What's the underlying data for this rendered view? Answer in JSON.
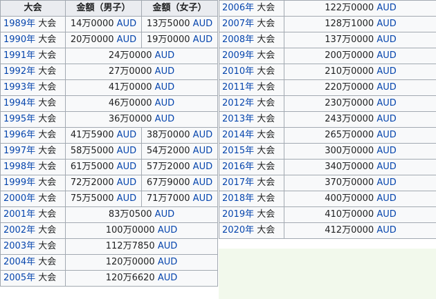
{
  "left_table": {
    "headers": [
      "大会",
      "金額（男子）",
      "金額（女子）"
    ],
    "rows": [
      {
        "year": "1989年",
        "suffix": "大会",
        "men": "14万0000",
        "women": "13万5000",
        "currency": "AUD"
      },
      {
        "year": "1990年",
        "suffix": "大会",
        "men": "20万0000",
        "women": "19万0000",
        "currency": "AUD"
      },
      {
        "year": "1991年",
        "suffix": "大会",
        "amount": "24万0000",
        "currency": "AUD"
      },
      {
        "year": "1992年",
        "suffix": "大会",
        "amount": "27万0000",
        "currency": "AUD"
      },
      {
        "year": "1993年",
        "suffix": "大会",
        "amount": "41万0000",
        "currency": "AUD"
      },
      {
        "year": "1994年",
        "suffix": "大会",
        "amount": "46万0000",
        "currency": "AUD"
      },
      {
        "year": "1995年",
        "suffix": "大会",
        "amount": "36万0000",
        "currency": "AUD"
      },
      {
        "year": "1996年",
        "suffix": "大会",
        "men": "41万5900",
        "women": "38万0000",
        "currency": "AUD"
      },
      {
        "year": "1997年",
        "suffix": "大会",
        "men": "58万5000",
        "women": "54万2000",
        "currency": "AUD"
      },
      {
        "year": "1998年",
        "suffix": "大会",
        "men": "61万5000",
        "women": "57万2000",
        "currency": "AUD"
      },
      {
        "year": "1999年",
        "suffix": "大会",
        "men": "72万2000",
        "women": "67万9000",
        "currency": "AUD"
      },
      {
        "year": "2000年",
        "suffix": "大会",
        "men": "75万5000",
        "women": "71万7000",
        "currency": "AUD"
      },
      {
        "year": "2001年",
        "suffix": "大会",
        "amount": "83万0500",
        "currency": "AUD"
      },
      {
        "year": "2002年",
        "suffix": "大会",
        "amount": "100万0000",
        "currency": "AUD"
      },
      {
        "year": "2003年",
        "suffix": "大会",
        "amount": "112万7850",
        "currency": "AUD"
      },
      {
        "year": "2004年",
        "suffix": "大会",
        "amount": "120万0000",
        "currency": "AUD"
      },
      {
        "year": "2005年",
        "suffix": "大会",
        "amount": "120万6620",
        "currency": "AUD"
      }
    ]
  },
  "right_table": {
    "rows": [
      {
        "year": "2006年",
        "suffix": "大会",
        "amount": "122万0000",
        "currency": "AUD"
      },
      {
        "year": "2007年",
        "suffix": "大会",
        "amount": "128万1000",
        "currency": "AUD"
      },
      {
        "year": "2008年",
        "suffix": "大会",
        "amount": "137万0000",
        "currency": "AUD"
      },
      {
        "year": "2009年",
        "suffix": "大会",
        "amount": "200万0000",
        "currency": "AUD"
      },
      {
        "year": "2010年",
        "suffix": "大会",
        "amount": "210万0000",
        "currency": "AUD"
      },
      {
        "year": "2011年",
        "suffix": "大会",
        "amount": "220万0000",
        "currency": "AUD"
      },
      {
        "year": "2012年",
        "suffix": "大会",
        "amount": "230万0000",
        "currency": "AUD"
      },
      {
        "year": "2013年",
        "suffix": "大会",
        "amount": "243万0000",
        "currency": "AUD"
      },
      {
        "year": "2014年",
        "suffix": "大会",
        "amount": "265万0000",
        "currency": "AUD"
      },
      {
        "year": "2015年",
        "suffix": "大会",
        "amount": "300万0000",
        "currency": "AUD"
      },
      {
        "year": "2016年",
        "suffix": "大会",
        "amount": "340万0000",
        "currency": "AUD"
      },
      {
        "year": "2017年",
        "suffix": "大会",
        "amount": "370万0000",
        "currency": "AUD"
      },
      {
        "year": "2018年",
        "suffix": "大会",
        "amount": "400万0000",
        "currency": "AUD"
      },
      {
        "year": "2019年",
        "suffix": "大会",
        "amount": "410万0000",
        "currency": "AUD"
      },
      {
        "year": "2020年",
        "suffix": "大会",
        "amount": "412万0000",
        "currency": "AUD"
      }
    ]
  },
  "colors": {
    "link": "#0645ad",
    "header_bg": "#eaecf0",
    "cell_bg": "#f8f9fa",
    "border": "#a2a9b1",
    "panel_bg": "#f2f9ec"
  }
}
